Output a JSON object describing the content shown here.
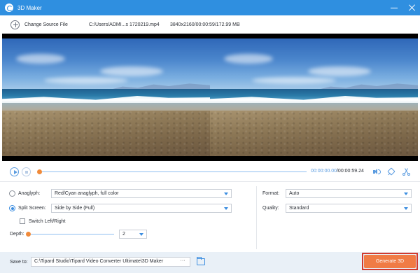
{
  "window": {
    "title": "3D Maker"
  },
  "source": {
    "change_label": "Change Source File",
    "path": "C:/Users/ADMI...s 1720219.mp4",
    "info": "3840x2160/00:00:59/172.99 MB"
  },
  "player": {
    "current_time": "00:00:00.00",
    "total_time": "/00:00:59.24",
    "progress": 0
  },
  "settings": {
    "anaglyph_label": "Anaglyph:",
    "anaglyph_value": "Red/Cyan anaglyph, full color",
    "anaglyph_selected": false,
    "split_label": "Split Screen:",
    "split_value": "Side by Side (Full)",
    "split_selected": true,
    "switch_label": "Switch Left/Right",
    "switch_checked": false,
    "depth_label": "Depth:",
    "depth_value": "2",
    "depth_level": 0.0,
    "format_label": "Format:",
    "format_value": "Auto",
    "quality_label": "Quality:",
    "quality_value": "Standard"
  },
  "save": {
    "label": "Save to:",
    "path": "C:\\Tipard Studio\\Tipard Video Converter Ultimate\\3D Maker",
    "browse_label": "···"
  },
  "generate_label": "Generate 3D",
  "colors": {
    "titlebar": "#2f8fe0",
    "accent": "#3b8de0",
    "knob": "#f08a3a",
    "generate": "#f07b45",
    "highlight_frame": "#d13a2f"
  }
}
